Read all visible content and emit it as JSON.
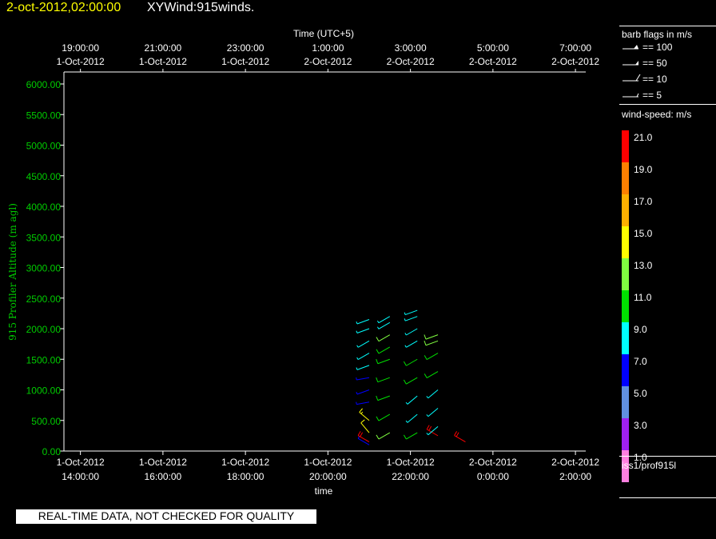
{
  "header": {
    "date_time": "2-oct-2012,02:00:00",
    "product": "XYWind:915winds."
  },
  "top_axis": {
    "label": "Time (UTC+5)",
    "ticks": [
      {
        "time": "19:00:00",
        "date": "1-Oct-2012"
      },
      {
        "time": "21:00:00",
        "date": "1-Oct-2012"
      },
      {
        "time": "23:00:00",
        "date": "1-Oct-2012"
      },
      {
        "time": "1:00:00",
        "date": "2-Oct-2012"
      },
      {
        "time": "3:00:00",
        "date": "2-Oct-2012"
      },
      {
        "time": "5:00:00",
        "date": "2-Oct-2012"
      },
      {
        "time": "7:00:00",
        "date": "2-Oct-2012"
      }
    ]
  },
  "barb_legend": {
    "title": "barb flags in m/s",
    "entries": [
      "== 100",
      "== 50",
      "== 10",
      "== 5"
    ]
  },
  "speed_legend": {
    "title": "wind-speed: m/s",
    "bins": [
      {
        "label": "21.0",
        "color": "#ff0000"
      },
      {
        "label": "19.0",
        "color": "#ff8000"
      },
      {
        "label": "17.0",
        "color": "#ffb000"
      },
      {
        "label": "15.0",
        "color": "#ffff00"
      },
      {
        "label": "13.0",
        "color": "#80ff40"
      },
      {
        "label": "11.0",
        "color": "#00e000"
      },
      {
        "label": "9.0",
        "color": "#00ffff"
      },
      {
        "label": "7.0",
        "color": "#0000ff"
      },
      {
        "label": "5.0",
        "color": "#6090e0"
      },
      {
        "label": "3.0",
        "color": "#a020f0"
      },
      {
        "label": "1.0",
        "color": "#ff80e0"
      }
    ]
  },
  "source_label": "iss1/prof915l",
  "quality_note": "REAL-TIME DATA, NOT CHECKED FOR QUALITY",
  "chart_data": {
    "type": "scatter",
    "ylabel": "915 Profiler Altitude (m agl)",
    "xlabel": "time",
    "ylim": [
      0,
      6200
    ],
    "y_ticks": [
      "0.00",
      "500.00",
      "1000.00",
      "1500.00",
      "2000.00",
      "2500.00",
      "3000.00",
      "3500.00",
      "4000.00",
      "4500.00",
      "5000.00",
      "5500.00",
      "6000.00"
    ],
    "x_ticks": [
      {
        "date": "1-Oct-2012",
        "time": "14:00:00"
      },
      {
        "date": "1-Oct-2012",
        "time": "16:00:00"
      },
      {
        "date": "1-Oct-2012",
        "time": "18:00:00"
      },
      {
        "date": "1-Oct-2012",
        "time": "20:00:00"
      },
      {
        "date": "1-Oct-2012",
        "time": "22:00:00"
      },
      {
        "date": "2-Oct-2012",
        "time": "0:00:00"
      },
      {
        "date": "2-Oct-2012",
        "time": "2:00:00"
      }
    ],
    "xlim_hours": [
      13.6,
      26.25
    ],
    "profiles": [
      {
        "time": "1-Oct-2012 21:00",
        "levels": [
          {
            "alt": 100,
            "speed": 7,
            "dir": 300
          },
          {
            "alt": 150,
            "speed": 20,
            "dir": 300
          },
          {
            "alt": 300,
            "speed": 14,
            "dir": 320
          },
          {
            "alt": 500,
            "speed": 15,
            "dir": 310
          },
          {
            "alt": 800,
            "speed": 7,
            "dir": 260
          },
          {
            "alt": 1000,
            "speed": 7,
            "dir": 250
          },
          {
            "alt": 1200,
            "speed": 7,
            "dir": 260
          },
          {
            "alt": 1400,
            "speed": 8,
            "dir": 250
          },
          {
            "alt": 1600,
            "speed": 9,
            "dir": 240
          },
          {
            "alt": 1800,
            "speed": 9,
            "dir": 240
          },
          {
            "alt": 2000,
            "speed": 9,
            "dir": 250
          },
          {
            "alt": 2150,
            "speed": 9,
            "dir": 250
          }
        ]
      },
      {
        "time": "1-Oct-2012 21:30",
        "levels": [
          {
            "alt": 300,
            "speed": 13,
            "dir": 240
          },
          {
            "alt": 600,
            "speed": 11,
            "dir": 240
          },
          {
            "alt": 900,
            "speed": 11,
            "dir": 250
          },
          {
            "alt": 1200,
            "speed": 11,
            "dir": 250
          },
          {
            "alt": 1500,
            "speed": 11,
            "dir": 250
          },
          {
            "alt": 1700,
            "speed": 11,
            "dir": 240
          },
          {
            "alt": 1900,
            "speed": 13,
            "dir": 240
          },
          {
            "alt": 2100,
            "speed": 9,
            "dir": 240
          },
          {
            "alt": 2200,
            "speed": 9,
            "dir": 240
          }
        ]
      },
      {
        "time": "1-Oct-2012 22:10",
        "levels": [
          {
            "alt": 300,
            "speed": 11,
            "dir": 240
          },
          {
            "alt": 600,
            "speed": 9,
            "dir": 230
          },
          {
            "alt": 900,
            "speed": 9,
            "dir": 230
          },
          {
            "alt": 1200,
            "speed": 11,
            "dir": 240
          },
          {
            "alt": 1500,
            "speed": 11,
            "dir": 240
          },
          {
            "alt": 1800,
            "speed": 9,
            "dir": 240
          },
          {
            "alt": 2000,
            "speed": 9,
            "dir": 240
          },
          {
            "alt": 2200,
            "speed": 9,
            "dir": 250
          },
          {
            "alt": 2300,
            "speed": 9,
            "dir": 250
          }
        ]
      },
      {
        "time": "1-Oct-2012 22:40",
        "levels": [
          {
            "alt": 250,
            "speed": 21,
            "dir": 300
          },
          {
            "alt": 400,
            "speed": 9,
            "dir": 230
          },
          {
            "alt": 700,
            "speed": 9,
            "dir": 230
          },
          {
            "alt": 1000,
            "speed": 9,
            "dir": 230
          },
          {
            "alt": 1300,
            "speed": 11,
            "dir": 240
          },
          {
            "alt": 1600,
            "speed": 11,
            "dir": 240
          },
          {
            "alt": 1800,
            "speed": 13,
            "dir": 250
          },
          {
            "alt": 1900,
            "speed": 13,
            "dir": 250
          }
        ]
      },
      {
        "time": "1-Oct-2012 23:20",
        "levels": [
          {
            "alt": 150,
            "speed": 21,
            "dir": 300
          }
        ]
      }
    ]
  }
}
